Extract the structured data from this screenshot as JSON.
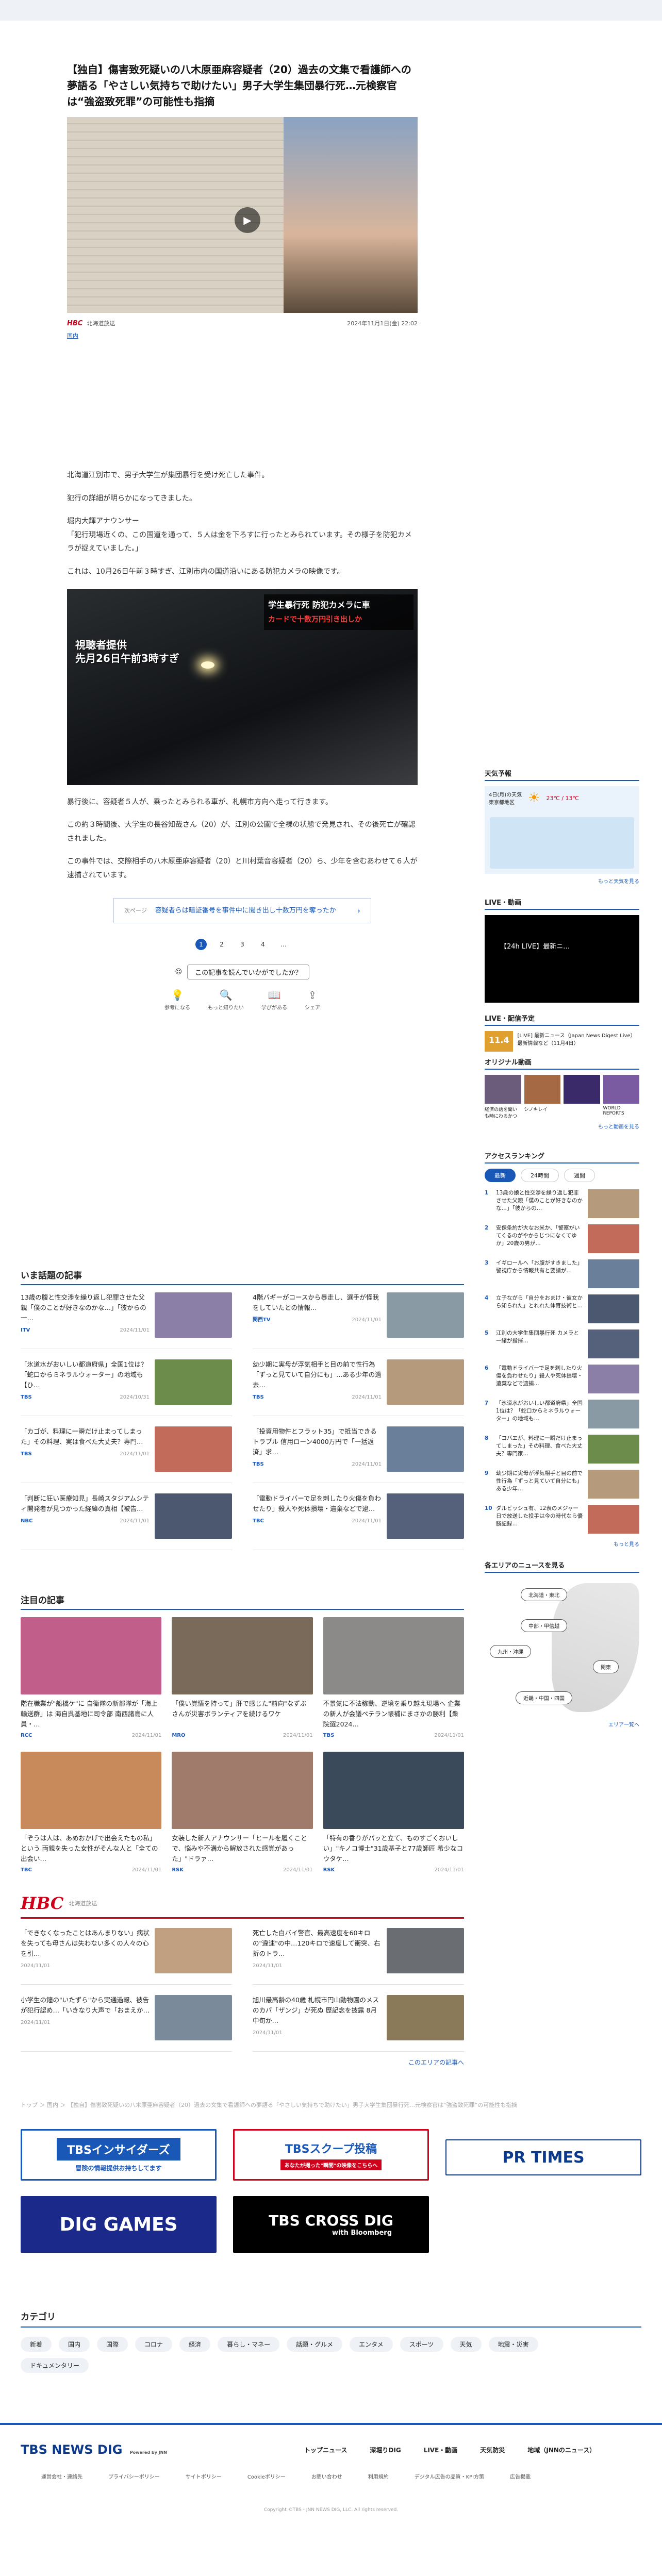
{
  "article": {
    "title": "【独自】傷害致死疑いの八木原亜麻容疑者（20）過去の文集で看護師への夢語る「やさしい気持ちで助けたい」男子大学生集団暴行死…元検察官は“強盗致死罪”の可能性も指摘",
    "source": "北海道放送",
    "source_logo": "HBC",
    "date": "2024年11月1日(金) 22:02",
    "tag": "国内",
    "paragraphs": [
      "北海道江別市で、男子大学生が集団暴行を受け死亡した事件。",
      "犯行の詳細が明らかになってきました。",
      "堀内大輝アナウンサー",
      "「犯行現場近くの、この国道を通って、５人は金を下ろすに行ったとみられています。その様子を防犯カメラが捉えていました。」",
      "これは、10月26日午前３時すぎ、江別市内の国道沿いにある防犯カメラの映像です。"
    ],
    "paragraphs2": [
      "暴行後に、容疑者５人が、乗ったとみられる車が、札幌市方向へ走って行きます。",
      "この約３時間後、大学生の長谷知哉さん（20）が、江別の公園で全裸の状態で発見され、その後死亡が確認されました。",
      "この事件では、交際相手の八木原亜麻容疑者（20）と川村葉音容疑者（20）ら、少年を含むあわせて６人が逮捕されています。"
    ],
    "image2_caption_line1": "視聴者提供",
    "image2_caption_line2": "先月26日午前3時すぎ",
    "image2_banner_line1": "学生暴行死 防犯カメラに車",
    "image2_banner_line2": "カードで十数万円引き出しか",
    "promo_label": "次ページ",
    "promo_text": "容疑者らは暗証番号を事件中に聞き出し十数万円を奪ったか",
    "pages": [
      "1",
      "2",
      "3",
      "4",
      "…"
    ],
    "reaction_prompt": "この記事を読んでいかがでしたか？",
    "reactions": [
      "参考になる",
      "もっと知りたい",
      "学びがある",
      "シェア"
    ]
  },
  "trending": {
    "title": "いま話題の記事",
    "items": [
      {
        "text": "13歳の腹と性交渉を繰り返し犯罪させた父親「僕のことが好きなのかな…」「彼からの一…",
        "src": "ITV",
        "date": "2024/11/01"
      },
      {
        "text": "4階バギーがコースから暴走し、選手が怪我をしていたとの情報…",
        "src": "関西TV",
        "date": "2024/11/01"
      },
      {
        "text": "「氷道水がおいしい都道府県」全国1位は？「蛇口からミネラルウォーター」の地域も【ひ…",
        "src": "TBS",
        "date": "2024/10/31"
      },
      {
        "text": "幼少期に実母が浮気相手と目の前で性行為「ずっと見ていて自分にも」…ある少年の過去…",
        "src": "TBS",
        "date": "2024/11/01"
      },
      {
        "text": "「カゴが、料理に一瞬だけ止まってしまった」その料理、実は食べた大丈夫？専門…",
        "src": "TBS",
        "date": "2024/11/01"
      },
      {
        "text": "「投資用物件とフラット35」で抵当できるトラブル 信用ローン4000万円で「一括返済」求…",
        "src": "TBS",
        "date": "2024/11/01"
      },
      {
        "text": "「判断に狂い医療知見」長崎スタジアムシティ開発者が見つかった経緯の真相【被告…",
        "src": "NBC",
        "date": "2024/11/01"
      },
      {
        "text": "「電動ドライバーで足を刺したり火傷を負わせたり」殺人や死体損壊・遺棄などで逮…",
        "src": "TBC",
        "date": "2024/11/01"
      }
    ]
  },
  "featured": {
    "title": "注目の記事",
    "items": [
      {
        "text": "階在職業が\"船橋ケ\"に 自衛隊の新部隊が「海上輸送群」は 海自呉基地に司令部 南西諸島に人員・…",
        "src": "RCC",
        "date": "2024/11/01"
      },
      {
        "text": "「僕い覚悟を持って」肝で感じた\"前向\"なずぶさんが災害ボランティアを続けるワケ",
        "src": "MRO",
        "date": "2024/11/01"
      },
      {
        "text": "不景気に不法稼動、逆境を乗り越え現場へ 企業の新人が会議ベテラン帳補にまさかの勝利【衆院選2024…",
        "src": "TBS",
        "date": "2024/11/01"
      },
      {
        "text": "「ぞうは人は、あめおかげで出会えたもの私」という 両親を失った女性がそんな人と「全ての出会い…",
        "src": "TBC",
        "date": "2024/11/01"
      },
      {
        "text": "女装した新人アナウンサー「ヒールを履くことで、悩みや不満から解放された感覚があった」\"ドラァ…",
        "src": "RSK",
        "date": "2024/11/01"
      },
      {
        "text": "「特有の香りがパッと立て、ものすごくおいしい」\"キノコ博士\"31歳基子と77歳師匠 希少なコウタケ…",
        "src": "RSK",
        "date": "2024/11/01"
      }
    ]
  },
  "hbc": {
    "logo": "HBC",
    "label": "北海道放送",
    "items": [
      {
        "text": "「できなくなったことはあんまりない」病状を失っても母さんは失わない多くの人々の心を引…",
        "date": "2024/11/01"
      },
      {
        "text": "死亡した白バイ警官、最高速度を60キロの\"違速\"の中…120キロで速度して衝突、右折のトラ…",
        "date": "2024/11/01"
      },
      {
        "text": "小学生の鐘の\"いたずら\"から実通過報、被告が犯行認め…「いきなり大声で「おまえか…",
        "date": "2024/11/01"
      },
      {
        "text": "旭川最高齢の40歳 札幌市円山動物園のメスのカバ「ザンジ」が死ぬ 歴記念を披露 8月中旬か…",
        "date": "2024/11/01"
      }
    ],
    "more": "このエリアの記事へ"
  },
  "sidebar": {
    "weather_title": "天気予報",
    "weather_date": "4日(月)の天気",
    "weather_place": "東京都地区",
    "weather_temp": "23℃ / 13℃",
    "weather_more": "もっと天気を見る",
    "live_title": "LIVE・動画",
    "live_label": "【24h LIVE】最新ニ…",
    "schedule_title": "LIVE・配信予定",
    "schedule_text": "[LIVE] 最新ニュース（Japan News Digest Live）最新情報など（11月4日）",
    "schedule_time": "11.4",
    "orig_title": "オリジナル動画",
    "origs": [
      "経済の話を聞いも時にわるかつ",
      "シノキレイ",
      "",
      "WORLD REPORTS"
    ],
    "orig_more": "もっと動画を見る",
    "ranking_title": "アクセスランキング",
    "ranking_tabs": [
      "最新",
      "24時間",
      "週間"
    ],
    "ranking": [
      "13歳の娘と性交渉を繰り返し犯罪させた父親「僕のことが好きなのかな…」「彼からの…",
      "安保条約が大なお米か、「警察がいてくるのがやからじつになくてゆか」20歳の男が…",
      "イギロールへ「お腹がすきました」警視庁から情報共有と要請が…",
      "立子ながら「自分をおまけ・彼女から知られた」とれれた体育技術と…",
      "江別の大学生集団暴行死 カメラと一緒が指揮…",
      "「電動ドライバーで足を刺したり火傷を負わせたり」殺人や死体損壊・遺棄などで逮捕…",
      "「氷道水がおいしい都道府県」全国1位は？「蛇口からミネラルウォーター」の地域も…",
      "「コバエが、料理に一瞬だけ止まってしまった」その料理、食べた大丈夫？専門家…",
      "幼少期に実母が浮気相手と目の前で性行為「ずっと見ていて自分にも」ある少年…",
      "ダルビッシュ有、12表のメジャー日で放送した投手は今の時代なら優勝記録…"
    ],
    "ranking_more": "もっと見る",
    "area_title": "各エリアのニュースを見る",
    "areas": [
      "北海道・東北",
      "中部・甲信越",
      "九州・沖縄",
      "関東",
      "近畿・中国・四国"
    ],
    "area_more": "エリア一覧へ"
  },
  "breadcrumb": "トップ ＞ 国内 ＞ 【独自】傷害致死疑いの八木原亜麻容疑者（20）過去の文集で看護師への夢語る「やさしい気持ちで助けたい」男子大学生集団暴行死…元検察官は“強盗致死罪”の可能性も指摘",
  "banners": {
    "insiders": "TBSインサイダーズ",
    "insiders_sub": "冒険の情報提供お持ちしてます",
    "scoop": "TBSスクープ投稿",
    "scoop_sub": "あなたが撮った\"瞬間\"の映像をこちらへ",
    "prtimes": "PR TIMES",
    "diggames": "DIG GAMES",
    "crossdig": "TBS CROSS DIG",
    "crossdig_sub": "with Bloomberg"
  },
  "categories": {
    "title": "カテゴリ",
    "items": [
      "新着",
      "国内",
      "国際",
      "コロナ",
      "経済",
      "暮らし・マネー",
      "話題・グルメ",
      "エンタメ",
      "スポーツ",
      "天気",
      "地震・災害",
      "ドキュメンタリー"
    ]
  },
  "footer": {
    "logo": "TBS NEWS DIG",
    "logo_sub": "Powered by JNN",
    "nav": [
      "トップニュース",
      "深堀りDIG",
      "LIVE・動画",
      "天気防災",
      "地域（JNNのニュース）"
    ],
    "sub": [
      "運営会社・連絡先",
      "プライバシーポリシー",
      "サイトポリシー",
      "Cookieポリシー",
      "お問い合わせ",
      "利用規約",
      "デジタル広告の品質・KPI方策",
      "広告掲載"
    ],
    "copyright": "Copyright ©TBS・JNN NEWS DIG, LLC. All rights reserved."
  }
}
